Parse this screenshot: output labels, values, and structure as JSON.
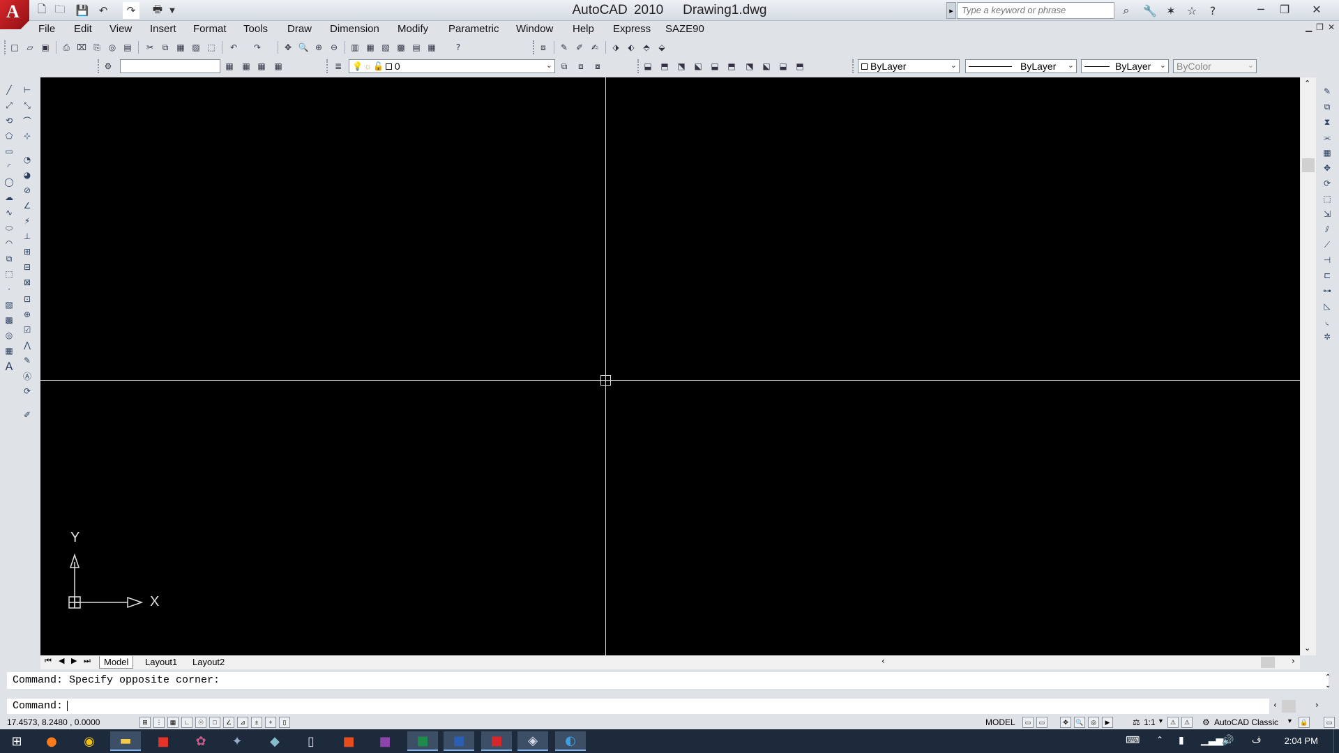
{
  "window": {
    "app_name": "AutoCAD 2010",
    "document": "Drawing1.dwg",
    "search_placeholder": "Type a keyword or phrase"
  },
  "menu": [
    "File",
    "Edit",
    "View",
    "Insert",
    "Format",
    "Tools",
    "Draw",
    "Dimension",
    "Modify",
    "Parametric",
    "Window",
    "Help",
    "Express",
    "SAZE90"
  ],
  "layer": {
    "current": "0"
  },
  "properties": {
    "color": "ByLayer",
    "linetype": "ByLayer",
    "lineweight": "ByLayer",
    "plotstyle": "ByColor"
  },
  "ucs": {
    "x_label": "X",
    "y_label": "Y"
  },
  "tabs": {
    "model": "Model",
    "layout1": "Layout1",
    "layout2": "Layout2"
  },
  "command": {
    "history": "Command: Specify opposite corner:",
    "prompt": "Command:"
  },
  "status": {
    "coordinates": "17.4573, 8.2480 , 0.0000",
    "space": "MODEL",
    "scale": "1:1",
    "workspace": "AutoCAD Classic"
  },
  "taskbar": {
    "time": "2:04 PM"
  },
  "colors": {
    "canvas": "#000000",
    "crosshair": "#d8d8d8",
    "taskbar": "#1c2a3b",
    "logo": "#d8272b"
  }
}
